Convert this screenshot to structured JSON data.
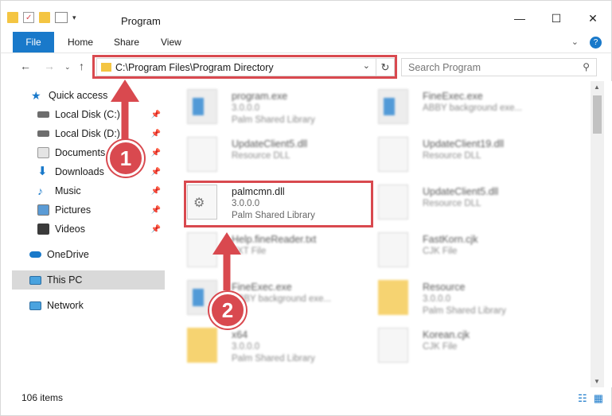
{
  "window": {
    "title": "Program",
    "minimize_icon": "minimize-icon",
    "maximize_icon": "maximize-icon",
    "close_icon": "close-icon"
  },
  "ribbon": {
    "tabs": [
      "File",
      "Home",
      "Share",
      "View"
    ]
  },
  "address_bar": {
    "path": "C:\\Program Files\\Program Directory"
  },
  "search": {
    "placeholder": "Search Program"
  },
  "sidebar": {
    "items": [
      {
        "label": "Quick access",
        "icon": "star-icon"
      },
      {
        "label": "Local Disk (C:)",
        "icon": "drive-icon"
      },
      {
        "label": "Local Disk (D:)",
        "icon": "drive-icon"
      },
      {
        "label": "Documents",
        "icon": "documents-icon"
      },
      {
        "label": "Downloads",
        "icon": "download-icon"
      },
      {
        "label": "Music",
        "icon": "music-icon"
      },
      {
        "label": "Pictures",
        "icon": "pictures-icon"
      },
      {
        "label": "Videos",
        "icon": "videos-icon"
      },
      {
        "label": "OneDrive",
        "icon": "cloud-icon"
      },
      {
        "label": "This PC",
        "icon": "computer-icon"
      },
      {
        "label": "Network",
        "icon": "network-icon"
      }
    ]
  },
  "files": [
    {
      "name": "program.exe",
      "line2": "3.0.0.0",
      "line3": "Palm Shared Library"
    },
    {
      "name": "FineExec.exe",
      "line2": "ABBY background exe...",
      "line3": ""
    },
    {
      "name": "UpdateClient5.dll",
      "line2": "Resource DLL",
      "line3": ""
    },
    {
      "name": "UpdateClient19.dll",
      "line2": "Resource DLL",
      "line3": ""
    },
    {
      "name": "palmcmn.dll",
      "line2": "3.0.0.0",
      "line3": "Palm Shared Library"
    },
    {
      "name": "UpdateClient5.dll",
      "line2": "Resource DLL",
      "line3": ""
    },
    {
      "name": "Help.fineReader.txt",
      "line2": "TXT File",
      "line3": ""
    },
    {
      "name": "FastKorn.cjk",
      "line2": "CJK File",
      "line3": ""
    },
    {
      "name": "FineExec.exe",
      "line2": "ABBY background exe...",
      "line3": ""
    },
    {
      "name": "Resource",
      "line2": "3.0.0.0",
      "line3": "Palm Shared Library"
    },
    {
      "name": "x64",
      "line2": "3.0.0.0",
      "line3": "Palm Shared Library"
    },
    {
      "name": "Korean.cjk",
      "line2": "CJK File",
      "line3": ""
    }
  ],
  "status": {
    "count": "106 items"
  },
  "annotations": {
    "step1": "1",
    "step2": "2",
    "accent": "#d9494f"
  }
}
